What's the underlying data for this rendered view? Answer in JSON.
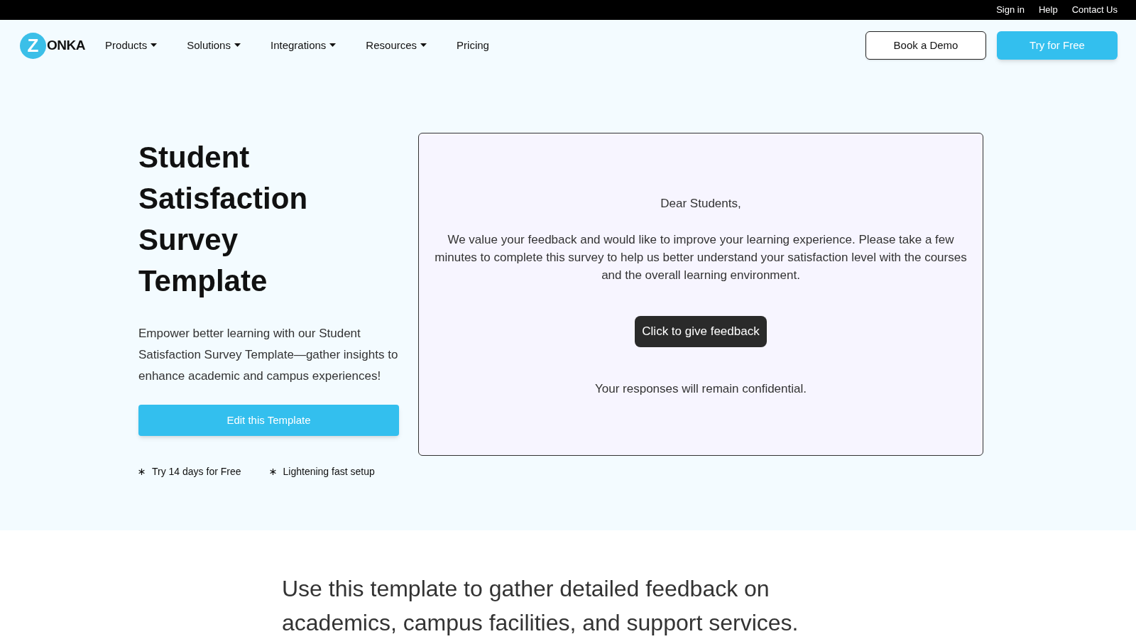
{
  "top_bar": {
    "links": [
      "Sign in",
      "Help",
      "Contact Us"
    ]
  },
  "nav": {
    "logo": {
      "initial": "Z",
      "rest": "ONKA"
    },
    "items": [
      {
        "label": "Products",
        "has_menu": true
      },
      {
        "label": "Solutions",
        "has_menu": true
      },
      {
        "label": "Integrations",
        "has_menu": true
      },
      {
        "label": "Resources",
        "has_menu": true
      },
      {
        "label": "Pricing",
        "has_menu": false
      }
    ],
    "buttons": [
      {
        "label": "Book a Demo",
        "kind": "outline"
      },
      {
        "label": "Try for Free",
        "kind": "primary"
      }
    ]
  },
  "hero": {
    "title": "Student Satisfaction Survey Template",
    "description": "Empower better learning with our Student Satisfaction Survey Template—gather insights to enhance academic and campus experiences!",
    "cta": "Edit this Template",
    "features": [
      "Try 14 days for Free",
      "Lightening fast setup"
    ]
  },
  "survey_preview": {
    "greeting": "Dear Students,",
    "message": "We value your feedback and would like to improve your learning experience. Please take a few minutes to complete this survey to help us better understand your satisfaction level with the courses and the overall learning environment.",
    "button": "Click to give feedback",
    "footer": "Your responses will remain confidential."
  },
  "intro": {
    "lines": [
      "Use this template to gather detailed feedback on",
      "academics, campus facilities, and support services."
    ]
  }
}
